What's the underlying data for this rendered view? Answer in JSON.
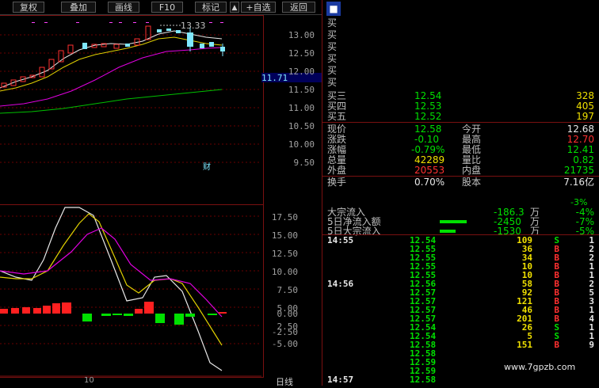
{
  "toolbar": {
    "buttons": [
      "复权",
      "叠加",
      "画线",
      "F10",
      "标记",
      "+自选",
      "返回"
    ],
    "up_icon": "up-arrow-icon"
  },
  "main_chart": {
    "price_labels": [
      "13.00",
      "12.50",
      "12.00",
      "11.50",
      "11.00",
      "10.50",
      "10.00",
      "9.50"
    ],
    "current_price_tag": "11.71",
    "high_marker": "13.33",
    "cai_label": "财"
  },
  "indicator_chart": {
    "labels": [
      "17.50",
      "15.00",
      "12.50",
      "10.00",
      "7.50",
      "5.00",
      "2.50",
      "0.00",
      "-2.50",
      "-5.00"
    ],
    "bottom_tick": "10",
    "day_line_label": "日线"
  },
  "order_book": {
    "buy_side_glyphs": [
      "买",
      "买",
      "买",
      "买",
      "买",
      "买"
    ],
    "rows": [
      {
        "label": "买三",
        "price": "12.54",
        "vol": "328"
      },
      {
        "label": "买四",
        "price": "12.53",
        "vol": "405"
      },
      {
        "label": "买五",
        "price": "12.52",
        "vol": "197"
      }
    ]
  },
  "quote": {
    "rows": [
      {
        "l1": "现价",
        "v1": "12.58",
        "c1": "green",
        "l2": "今开",
        "v2": "12.68",
        "c2": "white"
      },
      {
        "l1": "涨跌",
        "v1": "-0.10",
        "c1": "green",
        "l2": "最高",
        "v2": "12.70",
        "c2": "red"
      },
      {
        "l1": "涨幅",
        "v1": "-0.79%",
        "c1": "green",
        "l2": "最低",
        "v2": "12.41",
        "c2": "green"
      },
      {
        "l1": "总量",
        "v1": "42289",
        "c1": "yellow",
        "l2": "量比",
        "v2": "0.82",
        "c2": "green"
      },
      {
        "l1": "外盘",
        "v1": "20553",
        "c1": "red",
        "l2": "内盘",
        "v2": "21735",
        "c2": "green"
      },
      {
        "l1": "换手",
        "v1": "0.70%",
        "c1": "white",
        "l2": "股本",
        "v2": "7.16亿",
        "c2": "white"
      }
    ]
  },
  "capital_flow": {
    "rows": [
      {
        "label": "大宗流入",
        "value": "-186.3",
        "unit": "万",
        "pct": "-4%"
      },
      {
        "label": "5日净流入额",
        "value": "-2450",
        "unit": "万",
        "pct": "-7%"
      },
      {
        "label": "5日大宗流入",
        "value": "-1530",
        "unit": "万",
        "pct": "-5%"
      }
    ],
    "top_pct": "-3%"
  },
  "ticks": [
    {
      "time": "14:55",
      "price": "12.54",
      "vol": "109",
      "side": "S",
      "n": "1"
    },
    {
      "time": "",
      "price": "12.55",
      "vol": "36",
      "side": "B",
      "n": "2"
    },
    {
      "time": "",
      "price": "12.55",
      "vol": "34",
      "side": "B",
      "n": "2"
    },
    {
      "time": "",
      "price": "12.55",
      "vol": "10",
      "side": "B",
      "n": "1"
    },
    {
      "time": "",
      "price": "12.55",
      "vol": "10",
      "side": "B",
      "n": "1"
    },
    {
      "time": "14:56",
      "price": "12.56",
      "vol": "58",
      "side": "B",
      "n": "2"
    },
    {
      "time": "",
      "price": "12.57",
      "vol": "92",
      "side": "B",
      "n": "5"
    },
    {
      "time": "",
      "price": "12.57",
      "vol": "121",
      "side": "B",
      "n": "3"
    },
    {
      "time": "",
      "price": "12.57",
      "vol": "46",
      "side": "B",
      "n": "1"
    },
    {
      "time": "",
      "price": "12.57",
      "vol": "201",
      "side": "B",
      "n": "4"
    },
    {
      "time": "",
      "price": "12.54",
      "vol": "26",
      "side": "S",
      "n": "1"
    },
    {
      "time": "",
      "price": "12.54",
      "vol": "5",
      "side": "S",
      "n": "1"
    },
    {
      "time": "",
      "price": "12.58",
      "vol": "151",
      "side": "B",
      "n": "9"
    },
    {
      "time": "",
      "price": "12.58",
      "vol": "",
      "side": "",
      "n": ""
    },
    {
      "time": "",
      "price": "12.59",
      "vol": "",
      "side": "",
      "n": ""
    },
    {
      "time": "",
      "price": "12.59",
      "vol": "",
      "side": "",
      "n": ""
    },
    {
      "time": "14:57",
      "price": "12.58",
      "vol": "",
      "side": "",
      "n": ""
    }
  ],
  "watermark": "www.7gpzb.com",
  "colors": {
    "up": "#ff3030",
    "down": "#00e000",
    "cyan": "#7fe8ff",
    "grid": "#7a1010"
  }
}
